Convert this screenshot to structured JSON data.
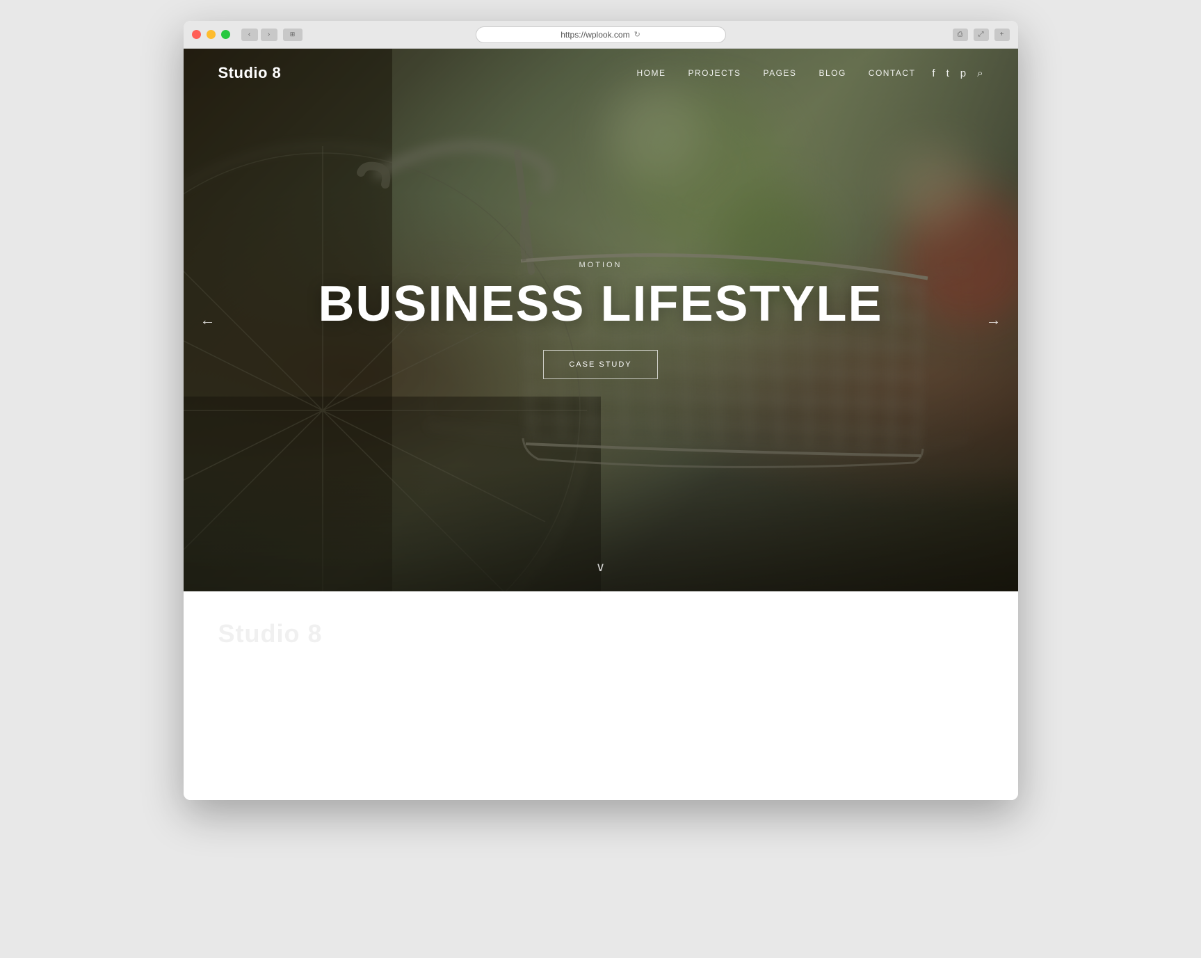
{
  "browser": {
    "url": "https://wplook.com",
    "reload_icon": "↻"
  },
  "nav": {
    "logo": "Studio 8",
    "items": [
      {
        "label": "HOME"
      },
      {
        "label": "PROJECTS"
      },
      {
        "label": "PAGES"
      },
      {
        "label": "BLOG"
      },
      {
        "label": "CONTACT"
      }
    ],
    "icons": {
      "facebook": "f",
      "twitter": "t",
      "pinterest": "p",
      "search": "⌕"
    }
  },
  "hero": {
    "tag": "MOTION",
    "title": "BUSINESS LIFESTYLE",
    "cta_label": "CASE STUDY",
    "arrow_left": "←",
    "arrow_right": "→",
    "scroll_icon": "∨"
  },
  "below": {
    "logo_watermark": "Studio 8"
  }
}
